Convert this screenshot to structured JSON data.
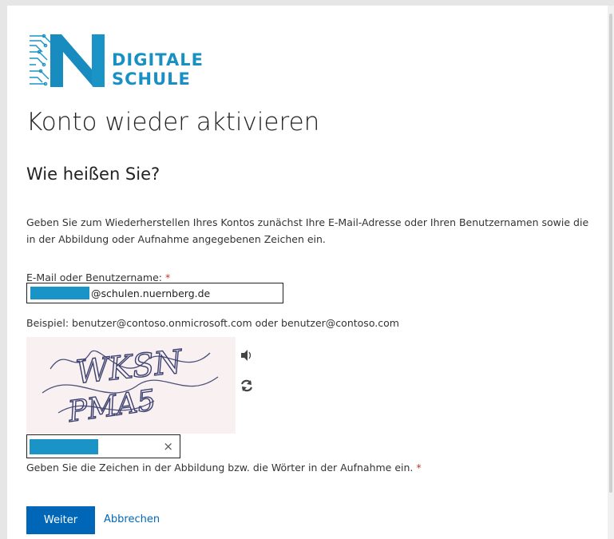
{
  "logo": {
    "line1": "DIGITALE",
    "line2": "SCHULE"
  },
  "page_title": "Konto wieder aktivieren",
  "section_title": "Wie heißen Sie?",
  "intro_text": "Geben Sie zum Wiederherstellen Ihres Kontos zunächst Ihre E-Mail-Adresse oder Ihren Benutzernamen sowie die in der Abbildung oder Aufnahme angegebenen Zeichen ein.",
  "email_field": {
    "label": "E-Mail oder Benutzername:",
    "required_marker": "*",
    "value_suffix": "@schulen.nuernberg.de",
    "example": "Beispiel: benutzer@contoso.onmicrosoft.com oder benutzer@contoso.com"
  },
  "captcha": {
    "line1": "WKSN",
    "line2": "PMA5",
    "hint": "Geben Sie die Zeichen in der Abbildung bzw. die Wörter in der Aufnahme ein.",
    "required_marker": "*",
    "clear_symbol": "×"
  },
  "buttons": {
    "next": "Weiter",
    "cancel": "Abbrechen"
  },
  "colors": {
    "brand_blue": "#1990c4",
    "primary_button": "#0067b8",
    "redaction": "#1a93c6"
  }
}
